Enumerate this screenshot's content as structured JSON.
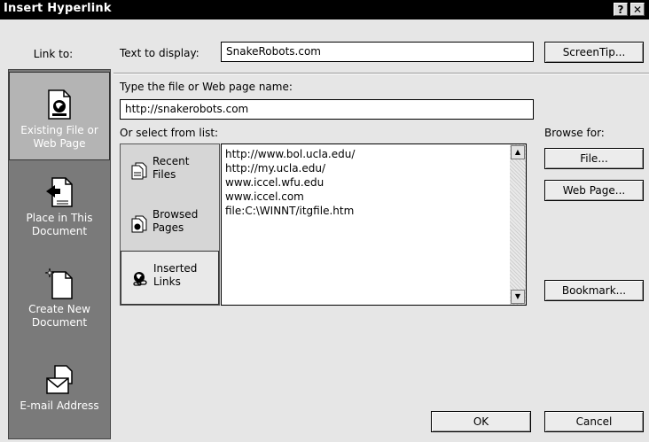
{
  "window": {
    "title": "Insert Hyperlink",
    "help_label": "?",
    "close_label": "✕"
  },
  "sidebar": {
    "label": "Link to:",
    "items": [
      {
        "label": "Existing File or Web Page",
        "icon": "existing-file-icon",
        "selected": true
      },
      {
        "label": "Place in This Document",
        "icon": "place-in-document-icon",
        "selected": false
      },
      {
        "label": "Create New Document",
        "icon": "new-document-icon",
        "selected": false
      },
      {
        "label": "E-mail Address",
        "icon": "email-icon",
        "selected": false
      }
    ]
  },
  "text_to_display": {
    "label": "Text to display:",
    "value": "SnakeRobots.com"
  },
  "screentip_button": "ScreenTip...",
  "file_name": {
    "label": "Type the file or Web page name:",
    "value": "http://snakerobots.com"
  },
  "select_from_list": {
    "label": "Or select from list:",
    "categories": [
      {
        "label_line1": "Recent",
        "label_line2": "Files",
        "icon": "recent-files-icon",
        "selected": false
      },
      {
        "label_line1": "Browsed",
        "label_line2": "Pages",
        "icon": "browsed-pages-icon",
        "selected": false
      },
      {
        "label_line1": "Inserted",
        "label_line2": "Links",
        "icon": "inserted-links-icon",
        "selected": true
      }
    ],
    "links": [
      "http://www.bol.ucla.edu/",
      "http://my.ucla.edu/",
      "www.iccel.wfu.edu",
      "www.iccel.com",
      "file:C:\\WINNT/itgfile.htm"
    ]
  },
  "browse_for": {
    "label": "Browse for:",
    "file_button": "File...",
    "webpage_button": "Web Page..."
  },
  "bookmark_button": "Bookmark...",
  "ok_button": "OK",
  "cancel_button": "Cancel"
}
